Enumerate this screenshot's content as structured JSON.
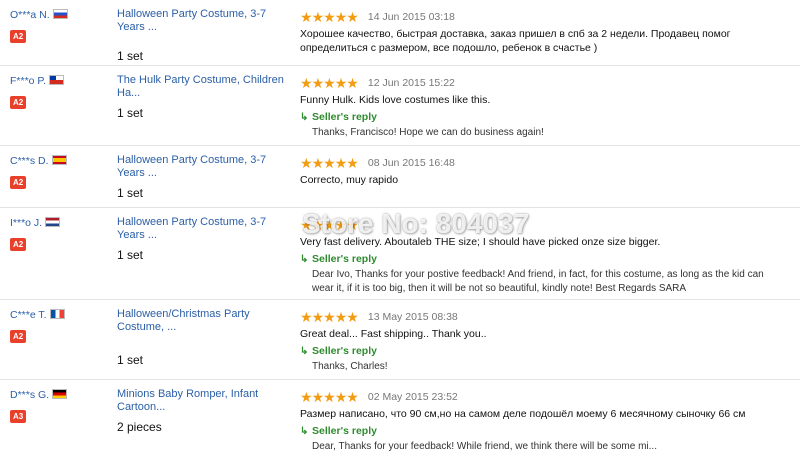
{
  "watermark": "Store No: 804037",
  "colors": {
    "link": "#2b5fa6",
    "star": "#f39c12",
    "level_badge": "#e8402a",
    "reply_green": "#2e8b2e"
  },
  "feedback": [
    {
      "buyer": "O***a N.",
      "flag": "russia-flag",
      "level": "A2",
      "product": "Halloween Party Costume, 3-7 Years ...",
      "quantity": "1 set",
      "stars": 5,
      "date": "14 Jun 2015 03:18",
      "review": "Хорошее качество, быстрая доставка, заказ пришел в спб за 2 недели. Продавец помог определиться с размером, все подошло, ребенок в счастье )"
    },
    {
      "buyer": "F***o P.",
      "flag": "chile-flag",
      "level": "A2",
      "product": "The Hulk Party Costume, Children Ha...",
      "quantity": "1 set",
      "stars": 5,
      "date": "12 Jun 2015 15:22",
      "review": "Funny Hulk. Kids love costumes like this.",
      "reply_label": "Seller's reply",
      "reply": "Thanks, Francisco! Hope we can do business again!"
    },
    {
      "buyer": "C***s D.",
      "flag": "spain-flag",
      "level": "A2",
      "product": "Halloween Party Costume, 3-7 Years ...",
      "quantity": "1 set",
      "stars": 5,
      "date": "08 Jun 2015 16:48",
      "review": "Correcto, muy rapido"
    },
    {
      "buyer": "I***o J.",
      "flag": "netherlands-flag",
      "level": "A2",
      "product": "Halloween Party Costume, 3-7 Years ...",
      "quantity": "1 set",
      "stars": 5,
      "date": "",
      "review": "Very fast delivery. Aboutaleb THE size; I should have picked onze size bigger.",
      "reply_label": "Seller's reply",
      "reply": "Dear Ivo, Thanks for your postive feedback! And friend, in fact, for this costume, as long as the kid can wear it, if it is too big, then it will be not so beautiful, kindly note! Best Regards SARA"
    },
    {
      "buyer": "C***e T.",
      "flag": "france-flag",
      "level": "A2",
      "product": "Halloween/Christmas Party Costume, ...",
      "quantity": "1 set",
      "stars": 5,
      "date": "13 May 2015 08:38",
      "review": "Great deal... Fast shipping.. Thank you..",
      "reply_label": "Seller's reply",
      "reply": "Thanks, Charles!"
    },
    {
      "buyer": "D***s G.",
      "flag": "germany-flag",
      "level": "A3",
      "product": "Minions Baby Romper, Infant Cartoon...",
      "quantity": "2 pieces",
      "stars": 5,
      "date": "02 May 2015 23:52",
      "review": "Размер написано, что 90 см,но на самом деле подошёл моему 6 месячному сыночку 66 см",
      "reply_label": "Seller's reply",
      "reply": "Dear, Thanks for your feedback! While friend, we think there will be some mi..."
    }
  ]
}
